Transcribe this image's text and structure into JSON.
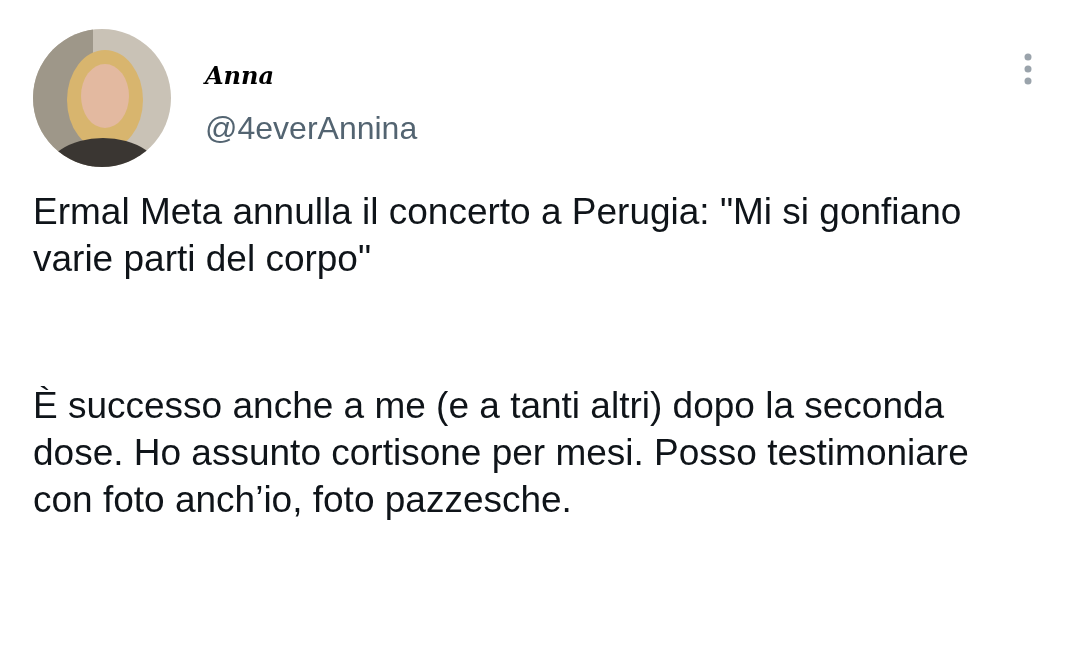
{
  "author": {
    "name": "Anna",
    "handle": "@4everAnnina"
  },
  "paragraphs": [
    "Ermal Meta annulla il concerto a Perugia: \"Mi si gonfiano varie parti del corpo\"",
    "È successo anche a me (e a tanti altri) dopo la seconda dose. Ho assunto cortisone per mesi. Posso testimoniare con foto anch’io, foto pazzesche."
  ]
}
